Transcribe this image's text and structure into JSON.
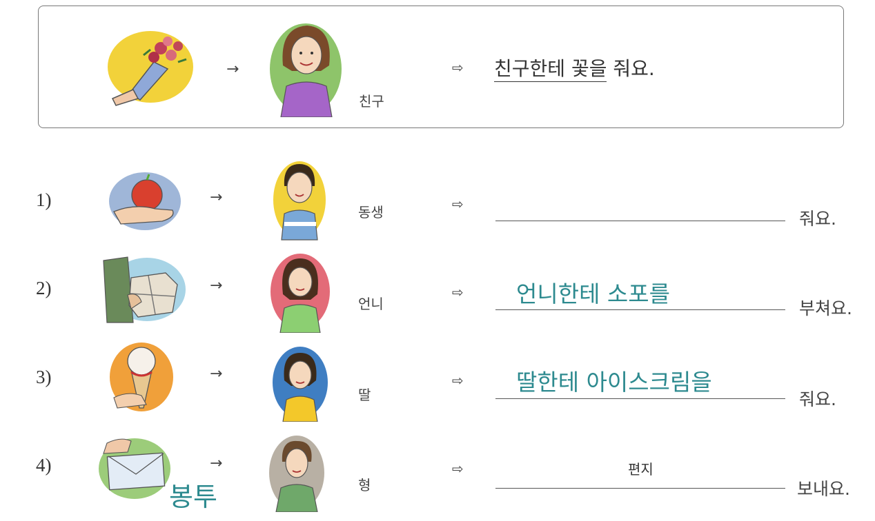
{
  "example": {
    "arrow": "→",
    "target": "친구",
    "implies": "⇨",
    "sentence_underlined": "친구한테 꽃을",
    "sentence_rest": " 줘요."
  },
  "rows": [
    {
      "num": "1)",
      "arrow": "→",
      "target": "동생",
      "implies": "⇨",
      "answer": "",
      "ending": "줘요."
    },
    {
      "num": "2)",
      "arrow": "→",
      "target": "언니",
      "implies": "⇨",
      "answer": "언니한테 소포를",
      "ending": "부쳐요."
    },
    {
      "num": "3)",
      "arrow": "→",
      "target": "딸",
      "implies": "⇨",
      "answer": "딸한테  아이스크림을",
      "ending": "줘요."
    },
    {
      "num": "4)",
      "arrow": "→",
      "target": "형",
      "implies": "⇨",
      "answer": "편지",
      "ending": "보내요."
    }
  ],
  "handwritten_note": "봉투"
}
